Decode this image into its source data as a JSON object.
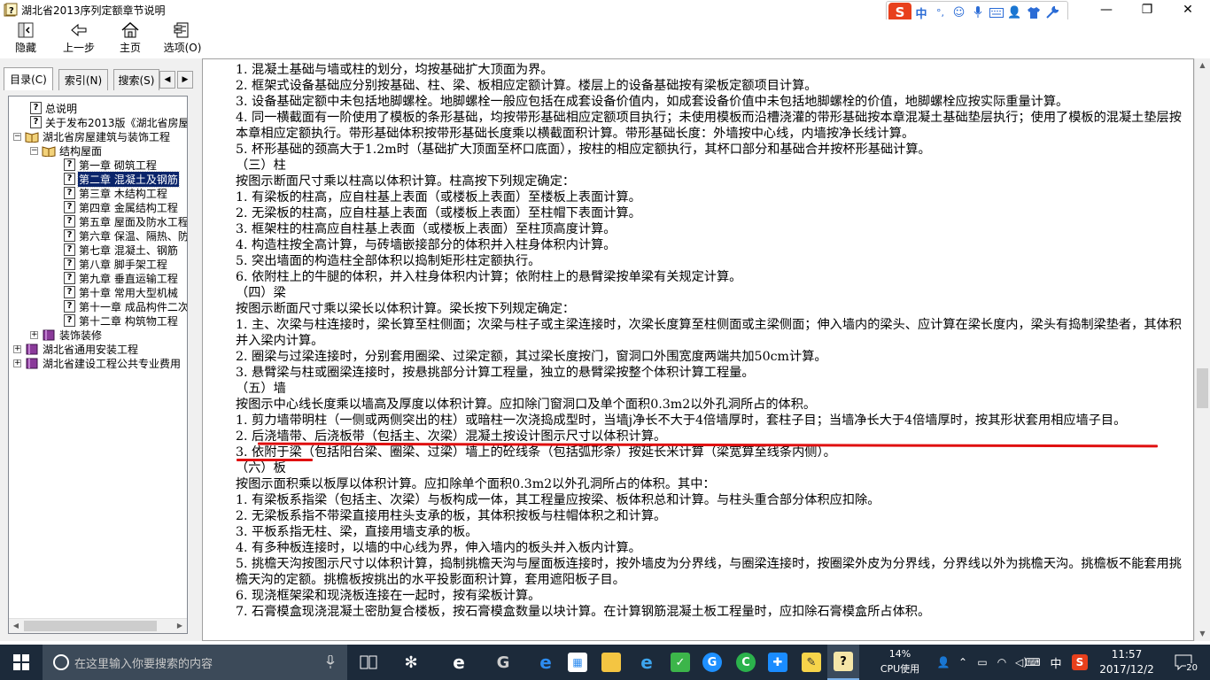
{
  "window": {
    "title": "湖北省2013序列定额章节说明",
    "controls": {
      "minimize": "—",
      "maximize": "❐",
      "close": "✕"
    }
  },
  "ime": {
    "logo": "S",
    "mode": "中",
    "punct": "°,",
    "items": [
      "emoji-icon",
      "mic-icon",
      "keyboard-icon",
      "user-icon",
      "shirt-icon",
      "wrench-icon"
    ]
  },
  "toolbar": {
    "hide": "隐藏",
    "back": "上一步",
    "home": "主页",
    "options": "选项(O)"
  },
  "tabs": {
    "contents": "目录(C)",
    "index": "索引(N)",
    "search": "搜索(S)"
  },
  "tree": [
    {
      "label": "总说明",
      "type": "doc"
    },
    {
      "label": "关于发布2013版《湖北省房屋",
      "type": "doc"
    },
    {
      "label": "湖北省房屋建筑与装饰工程",
      "type": "book-open"
    },
    {
      "label": "结构屋面",
      "type": "book-open"
    },
    {
      "label": "第一章 砌筑工程",
      "type": "doc"
    },
    {
      "label": "第二章 混凝土及钢筋",
      "type": "doc",
      "selected": true
    },
    {
      "label": "第三章 木结构工程",
      "type": "doc"
    },
    {
      "label": "第四章 金属结构工程",
      "type": "doc"
    },
    {
      "label": "第五章 屋面及防水工程",
      "type": "doc"
    },
    {
      "label": "第六章 保温、隔热、防",
      "type": "doc"
    },
    {
      "label": "第七章 混凝土、钢筋",
      "type": "doc"
    },
    {
      "label": "第八章 脚手架工程",
      "type": "doc"
    },
    {
      "label": "第九章 垂直运输工程",
      "type": "doc"
    },
    {
      "label": "第十章 常用大型机械",
      "type": "doc"
    },
    {
      "label": "第十一章 成品构件二次",
      "type": "doc"
    },
    {
      "label": "第十二章 构筑物工程",
      "type": "doc"
    },
    {
      "label": "装饰装修",
      "type": "book"
    },
    {
      "label": "湖北省通用安装工程",
      "type": "book"
    },
    {
      "label": "湖北省建设工程公共专业费用",
      "type": "book"
    }
  ],
  "content": {
    "lines": [
      "1. 混凝土基础与墙或柱的划分，均按基础扩大顶面为界。",
      "2. 框架式设备基础应分别按基础、柱、梁、板相应定额计算。楼层上的设备基础按有梁板定额项目计算。",
      "3. 设备基础定额中未包括地脚螺栓。地脚螺栓一般应包括在成套设备价值内，如成套设备价值中未包括地脚螺栓的价值，地脚螺栓应按实际重量计算。",
      "4. 同一横截面有一阶使用了模板的条形基础，均按带形基础相应定额项目执行；未使用模板而沿槽浇灌的带形基础按本章混凝土基础垫层执行；使用了模板的混凝土垫层按本章相应定额执行。带形基础体积按带形基础长度乘以横截面积计算。带形基础长度：外墙按中心线，内墙按净长线计算。",
      "5. 杯形基础的颈高大于1.2m时（基础扩大顶面至杯口底面），按柱的相应定额执行，其杯口部分和基础合并按杯形基础计算。",
      "（三）柱",
      "按图示断面尺寸乘以柱高以体积计算。柱高按下列规定确定：",
      "1. 有梁板的柱高，应自柱基上表面（或楼板上表面）至楼板上表面计算。",
      "2. 无梁板的柱高，应自柱基上表面（或楼板上表面）至柱帽下表面计算。",
      "3. 框架柱的柱高应自柱基上表面（或楼板上表面）至柱顶高度计算。",
      "4. 构造柱按全高计算，与砖墙嵌接部分的体积并入柱身体积内计算。",
      "5. 突出墙面的构造柱全部体积以捣制矩形柱定额执行。",
      "6. 依附柱上的牛腿的体积，并入柱身体积内计算；依附柱上的悬臂梁按单梁有关规定计算。",
      "（四）梁",
      "按图示断面尺寸乘以梁长以体积计算。梁长按下列规定确定：",
      "1. 主、次梁与柱连接时，梁长算至柱侧面；次梁与柱子或主梁连接时，次梁长度算至柱侧面或主梁侧面；伸入墙内的梁头、应计算在梁长度内，梁头有捣制梁垫者，其体积并入梁内计算。",
      "2. 圈梁与过梁连接时，分别套用圈梁、过梁定额，其过梁长度按门，窗洞口外围宽度两端共加50cm计算。",
      "3. 悬臂梁与柱或圈梁连接时，按悬挑部分计算工程量，独立的悬臂梁按整个体积计算工程量。",
      "（五）墙",
      "按图示中心线长度乘以墙高及厚度以体积计算。应扣除门窗洞口及单个面积0.3m2以外孔洞所占的体积。",
      "1. 剪力墙带明柱（一侧或两侧突出的柱）或暗柱一次浇捣成型时，当墙j净长不大于4倍墙厚时，套柱子目；当墙净长大于4倍墙厚时，按其形状套用相应墙子目。",
      "2. 后浇墙带、后浇板带（包括主、次梁）混凝土按设计图示尺寸以体积计算。",
      "3. 依附于梁（包括阳台梁、圈梁、过梁）墙上的砼线条（包括弧形条）按延长米计算（梁宽算至线条内侧）。",
      "（六）板",
      "按图示面积乘以板厚以体积计算。应扣除单个面积0.3m2以外孔洞所占的体积。其中：",
      "1. 有梁板系指梁（包括主、次梁）与板构成一体，其工程量应按梁、板体积总和计算。与柱头重合部分体积应扣除。",
      "2. 无梁板系指不带梁直接用柱头支承的板，其体积按板与柱帽体积之和计算。",
      "3. 平板系指无柱、梁，直接用墙支承的板。",
      "4. 有多种板连接时，以墙的中心线为界，伸入墙内的板头并入板内计算。",
      "5. 挑檐天沟按图示尺寸以体积计算，捣制挑檐天沟与屋面板连接时，按外墙皮为分界线，与圈梁连接时，按圈梁外皮为分界线，分界线以外为挑檐天沟。挑檐板不能套用挑檐天沟的定额。挑檐板按挑出的水平投影面积计算，套用遮阳板子目。",
      "6. 现浇框架梁和现浇板连接在一起时，按有梁板计算。",
      "7. 石膏模盒现浇混凝土密肋复合楼板，按石膏模盒数量以块计算。在计算钢筋混凝土板工程量时，应扣除石膏模盒所占体积。"
    ]
  },
  "taskbar": {
    "search_placeholder": "在这里输入你要搜索的内容",
    "cpu_percent": "14%",
    "cpu_label": "CPU使用",
    "lang": "中",
    "time": "11:57",
    "date": "2017/12/2",
    "notifications": "20"
  },
  "colors": {
    "selection": "#0a246a",
    "annotation": "#e01010",
    "taskbar": "#1c2a3a"
  }
}
